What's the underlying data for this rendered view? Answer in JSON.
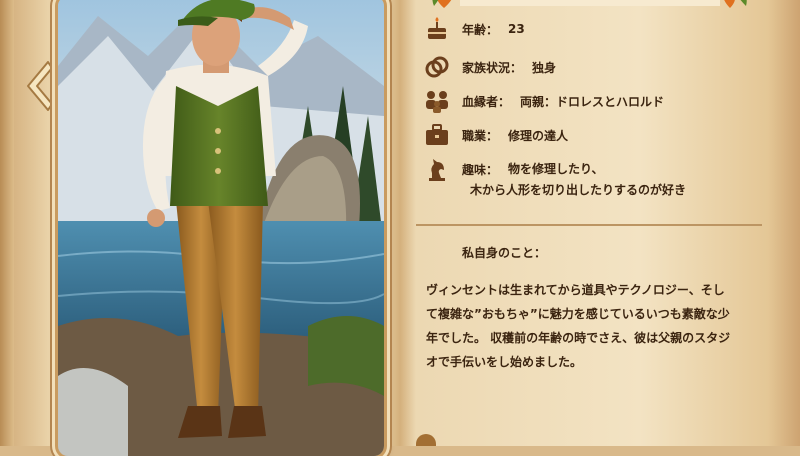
{
  "navigation": {
    "prev_icon": "chevron-left-icon"
  },
  "profile": {
    "age_label": "年齢：",
    "age_value": "23",
    "marital_label": "家族状況：",
    "marital_value": "独身",
    "relatives_label": "血縁者：",
    "relatives_value": "両親：ドロレスとハロルド",
    "occupation_label": "職業：",
    "occupation_value": "修理の達人",
    "hobby_label": "趣味：",
    "hobby_value_line1": "物を修理したり、",
    "hobby_value_line2": "木から人形を切り出したりするのが好き"
  },
  "about": {
    "title": "私自身のこと：",
    "line1": "ヴィンセントは生まれてから道具やテクノロジー、そし",
    "line2": "て複雑な”おもちゃ”に魅力を感じているいつも素敵な少",
    "line3": "年でした。 収穫前の年齢の時でさえ、彼は父親のスタジ",
    "line4": "オで手伝いをし始めました。"
  },
  "icons": {
    "age": "birthday-cake-icon",
    "marital": "rings-icon",
    "relatives": "family-icon",
    "occupation": "briefcase-icon",
    "hobby": "chess-knight-icon"
  },
  "colors": {
    "text": "#3b2410",
    "icon": "#6b3f1c",
    "page": "#f1dfbd",
    "frame": "#c99b5f"
  }
}
